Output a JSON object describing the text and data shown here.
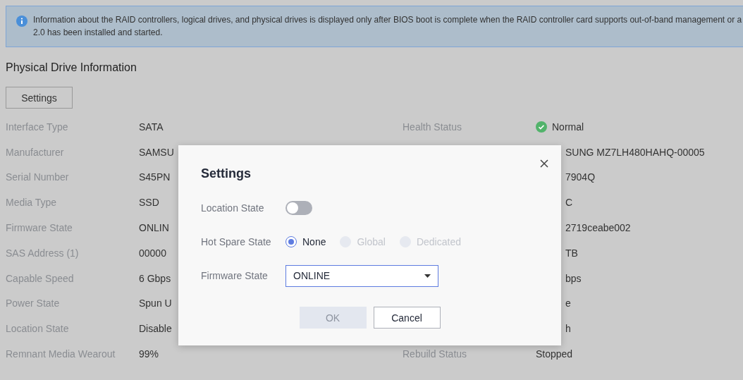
{
  "notice": {
    "text": "Information about the RAID controllers, logical drives, and physical drives is displayed only after BIOS boot is complete when the RAID controller card supports out-of-band management or a 2.0 has been installed and started."
  },
  "section_title": "Physical Drive Information",
  "settings_button": "Settings",
  "left_rows": [
    {
      "label": "Interface Type",
      "value": "SATA"
    },
    {
      "label": "Manufacturer",
      "value": "SAMSU"
    },
    {
      "label": "Serial Number",
      "value": "S45PN"
    },
    {
      "label": "Media Type",
      "value": "SSD"
    },
    {
      "label": "Firmware State",
      "value": "ONLIN"
    },
    {
      "label": "SAS Address (1)",
      "value": "00000"
    },
    {
      "label": "Capable Speed",
      "value": "6 Gbps"
    },
    {
      "label": "Power State",
      "value": "Spun U"
    },
    {
      "label": "Location State",
      "value": "Disable"
    },
    {
      "label": "Remnant Media Wearout",
      "value": "99%"
    }
  ],
  "right_rows": [
    {
      "label": "Health Status",
      "value": "Normal",
      "kind": "status"
    },
    {
      "value": "SUNG MZ7LH480HAHQ-00005",
      "kind": "plain"
    },
    {
      "value": "7904Q",
      "kind": "plain"
    },
    {
      "value": "C",
      "kind": "plain"
    },
    {
      "value": "2719ceabe002",
      "kind": "plain"
    },
    {
      "value": "TB",
      "kind": "plain"
    },
    {
      "value": "bps",
      "kind": "plain"
    },
    {
      "value": "e",
      "kind": "plain"
    },
    {
      "value": "h",
      "kind": "plain"
    },
    {
      "label": "Rebuild Status",
      "value": "Stopped",
      "kind": "plain"
    }
  ],
  "dialog": {
    "title": "Settings",
    "location": {
      "label": "Location State",
      "on": false
    },
    "hot_spare": {
      "label": "Hot Spare State",
      "options": [
        {
          "label": "None",
          "selected": true,
          "disabled": false
        },
        {
          "label": "Global",
          "selected": false,
          "disabled": true
        },
        {
          "label": "Dedicated",
          "selected": false,
          "disabled": true
        }
      ]
    },
    "firmware": {
      "label": "Firmware State",
      "value": "ONLINE"
    },
    "buttons": [
      {
        "label": "OK",
        "disabled": true
      },
      {
        "label": "Cancel",
        "disabled": false
      }
    ]
  }
}
